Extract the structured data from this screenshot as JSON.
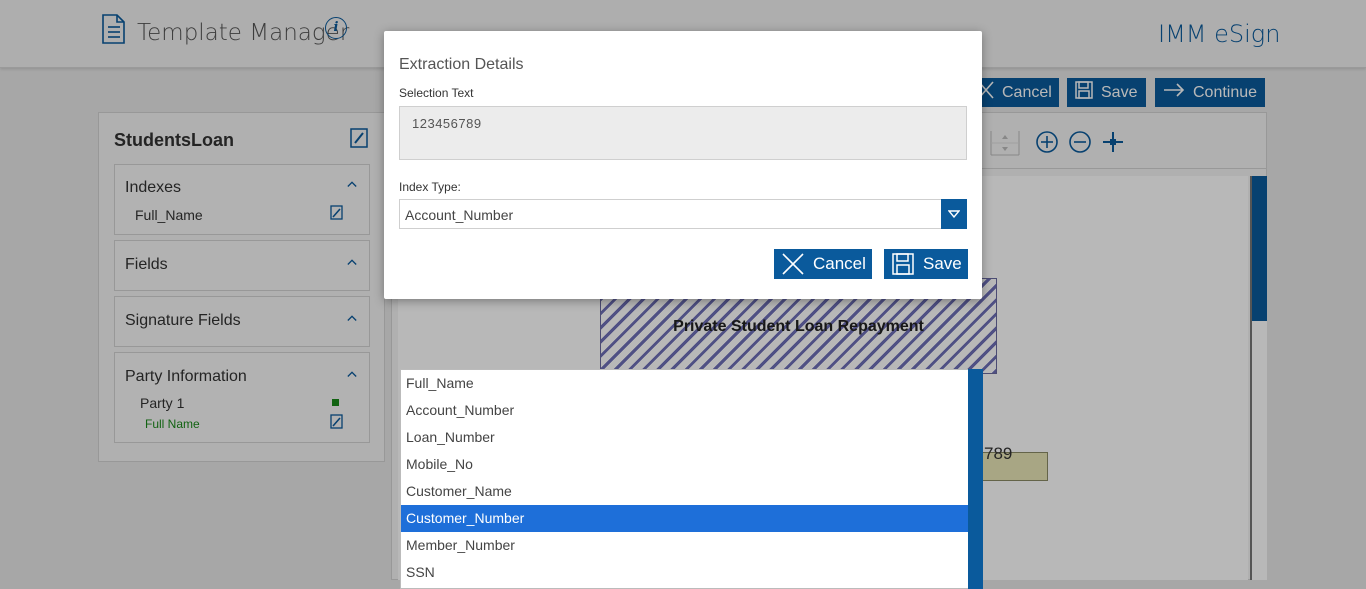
{
  "header": {
    "title": "Template Manager",
    "brand": "IMM eSign",
    "info_icon": "i"
  },
  "toolbar": {
    "cancel_label": "Cancel",
    "save_label": "Save",
    "continue_label": "Continue"
  },
  "left_panel": {
    "template_name": "StudentsLoan",
    "sections": [
      {
        "title": "Indexes",
        "items": [
          "Full_Name"
        ]
      },
      {
        "title": "Fields",
        "items": []
      },
      {
        "title": "Signature Fields",
        "items": []
      },
      {
        "title": "Party Information",
        "party": "Party 1",
        "party_field": "Full Name",
        "party_color": "#1a8a1a"
      }
    ]
  },
  "document": {
    "title_text": "Private Student Loan Repayment",
    "field_text": "789"
  },
  "dialog": {
    "title": "Extraction Details",
    "selection_label": "Selection Text",
    "selection_value": "123456789",
    "index_label": "Index Type:",
    "index_value": "Account_Number",
    "cancel_label": "Cancel",
    "save_label": "Save"
  },
  "dropdown": {
    "options": [
      "Full_Name",
      "Account_Number",
      "Loan_Number",
      "Mobile_No",
      "Customer_Name",
      "Customer_Number",
      "Member_Number",
      "SSN"
    ],
    "highlighted": "Customer_Number"
  },
  "colors": {
    "accent": "#0a5a9c",
    "highlight": "#1e6fd9"
  }
}
